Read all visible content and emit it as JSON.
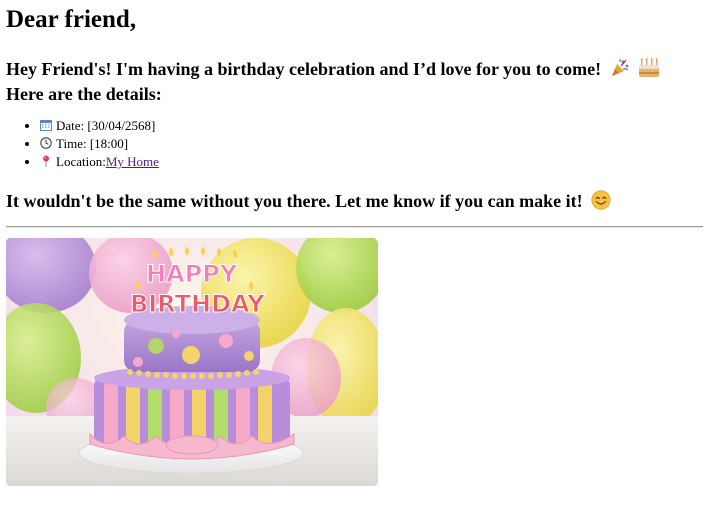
{
  "greeting": "Dear friend,",
  "intro": {
    "line1": "Hey Friend's! I'm having a birthday celebration and I’d love for you to come!",
    "line2": "Here are the details:"
  },
  "details": {
    "date_label": "Date: [30/04/2568]",
    "time_label": "Time: [18:00]",
    "location_prefix": "Location:",
    "location_link": "My Home"
  },
  "closing": "It wouldn't be the same without you there. Let me know if you can make it!",
  "photo": {
    "cake_text_top": "HAPPY",
    "cake_text_bottom": "BIRTHDAY"
  },
  "icons": {
    "party": "party-popper-icon",
    "cake": "birthday-cake-icon",
    "calendar": "calendar-icon",
    "clock": "clock-icon",
    "pin": "pushpin-icon",
    "smile": "smiling-face-icon"
  },
  "colors": {
    "link": "#551A8B",
    "divider": "#9a9a9a"
  }
}
